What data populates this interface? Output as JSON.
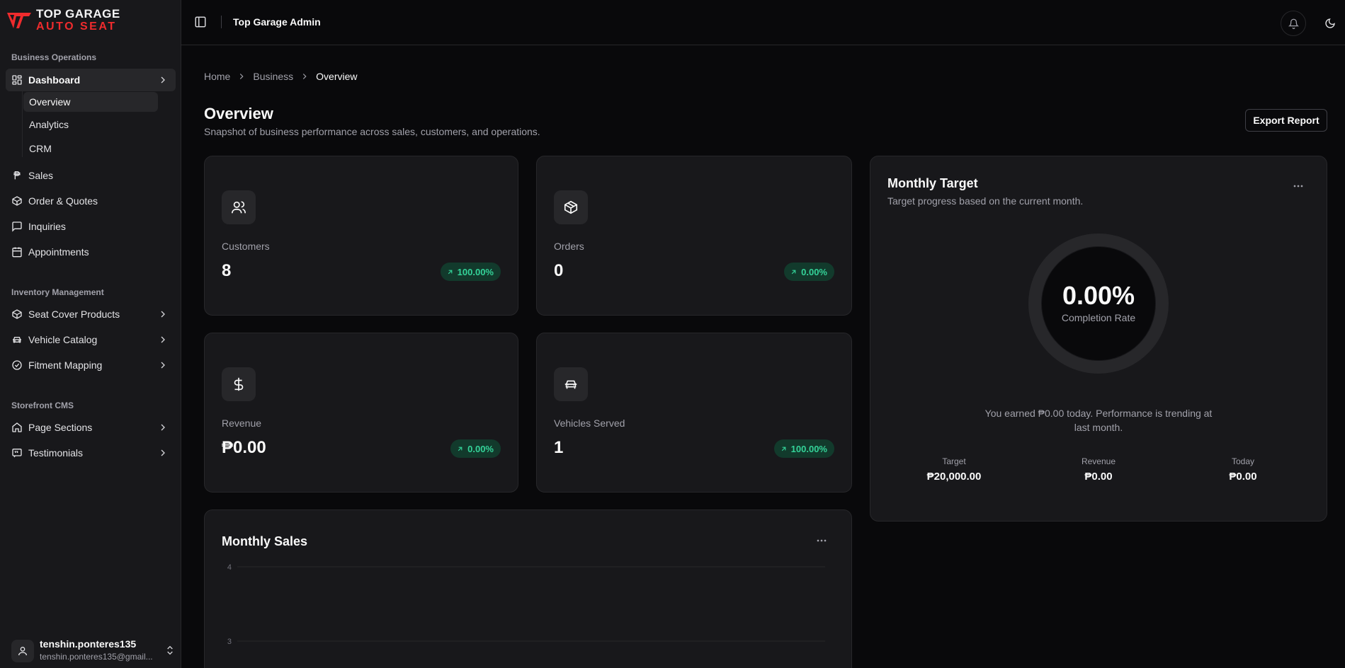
{
  "brand": {
    "line1": "TOP GARAGE",
    "line2": "AUTO SEAT",
    "accent": "#ef2b2d"
  },
  "sidebar": {
    "groups": [
      {
        "label": "Business Operations"
      },
      {
        "label": "Inventory Management"
      },
      {
        "label": "Storefront CMS"
      }
    ],
    "dashboard": {
      "label": "Dashboard",
      "icon": "layout-dashboard-icon",
      "sub": [
        "Overview",
        "Analytics",
        "CRM"
      ]
    },
    "items": [
      {
        "label": "Sales",
        "icon": "peso-icon"
      },
      {
        "label": "Order & Quotes",
        "icon": "package-icon"
      },
      {
        "label": "Inquiries",
        "icon": "message-square-icon"
      },
      {
        "label": "Appointments",
        "icon": "calendar-icon"
      },
      {
        "label": "Seat Cover Products",
        "icon": "package-icon"
      },
      {
        "label": "Vehicle Catalog",
        "icon": "car-icon"
      },
      {
        "label": "Fitment Mapping",
        "icon": "check-circle-icon"
      },
      {
        "label": "Page Sections",
        "icon": "home-icon"
      },
      {
        "label": "Testimonials",
        "icon": "message-quote-icon"
      }
    ],
    "user": {
      "name": "tenshin.ponteres135",
      "email": "tenshin.ponteres135@gmail..."
    }
  },
  "topbar": {
    "title": "Top Garage Admin"
  },
  "breadcrumb": [
    "Home",
    "Business",
    "Overview"
  ],
  "page": {
    "title": "Overview",
    "subtitle": "Snapshot of business performance across sales, customers, and operations.",
    "export_label": "Export Report"
  },
  "stats": [
    {
      "label": "Customers",
      "value": "8",
      "change": "100.00%",
      "icon": "users-icon"
    },
    {
      "label": "Orders",
      "value": "0",
      "change": "0.00%",
      "icon": "box-icon"
    },
    {
      "label": "Revenue",
      "value": "₱0.00",
      "change": "0.00%",
      "icon": "dollar-icon"
    },
    {
      "label": "Vehicles Served",
      "value": "1",
      "change": "100.00%",
      "icon": "car-icon"
    }
  ],
  "target": {
    "title": "Monthly Target",
    "subtitle": "Target progress based on the current month.",
    "completion": "0.00%",
    "completion_fraction": 0,
    "completion_label": "Completion Rate",
    "message": "You earned ₱0.00 today. Performance is trending at last month.",
    "stats": [
      {
        "label": "Target",
        "value": "₱20,000.00"
      },
      {
        "label": "Revenue",
        "value": "₱0.00"
      },
      {
        "label": "Today",
        "value": "₱0.00"
      }
    ]
  },
  "sales": {
    "title": "Monthly Sales"
  },
  "chart_data": {
    "type": "bar",
    "title": "Monthly Sales",
    "y_ticks_visible": [
      4,
      3
    ],
    "categories": [],
    "values": [],
    "grid": true
  },
  "colors": {
    "positive": "#34d399",
    "positive_bg": "#123a2c",
    "card": "#18181b",
    "border": "#27272a"
  }
}
